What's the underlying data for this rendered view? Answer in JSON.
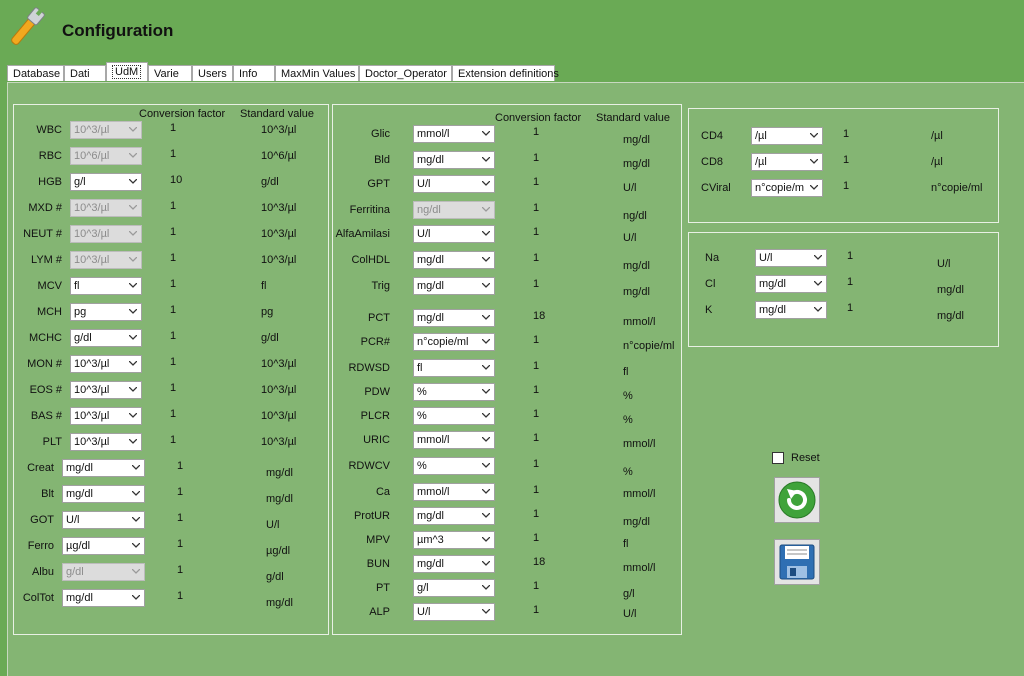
{
  "header": {
    "title": "Configuration",
    "icon": "wrench-icon"
  },
  "tabs": [
    {
      "label": "Database"
    },
    {
      "label": "Dati"
    },
    {
      "label": "UdM",
      "active": true
    },
    {
      "label": "Varie"
    },
    {
      "label": "Users"
    },
    {
      "label": "Info"
    },
    {
      "label": "MaxMin Values"
    },
    {
      "label": "Doctor_Operator"
    },
    {
      "label": "Extension definitions"
    }
  ],
  "group1": {
    "header_factor": "Conversion factor",
    "header_standard": "Standard value",
    "rows": [
      {
        "name": "WBC",
        "unit": "10^3/µl",
        "disabled": true,
        "factor": "1",
        "standard": "10^3/µl"
      },
      {
        "name": "RBC",
        "unit": "10^6/µl",
        "disabled": true,
        "factor": "1",
        "standard": "10^6/µl"
      },
      {
        "name": "HGB",
        "unit": "g/l",
        "disabled": false,
        "factor": "10",
        "standard": "g/dl"
      },
      {
        "name": "MXD #",
        "unit": "10^3/µl",
        "disabled": true,
        "factor": "1",
        "standard": "10^3/µl"
      },
      {
        "name": "NEUT #",
        "unit": "10^3/µl",
        "disabled": true,
        "factor": "1",
        "standard": "10^3/µl"
      },
      {
        "name": "LYM #",
        "unit": "10^3/µl",
        "disabled": true,
        "factor": "1",
        "standard": "10^3/µl"
      },
      {
        "name": "MCV",
        "unit": "fl",
        "disabled": false,
        "factor": "1",
        "standard": "fl"
      },
      {
        "name": "MCH",
        "unit": "pg",
        "disabled": false,
        "factor": "1",
        "standard": "pg"
      },
      {
        "name": "MCHC",
        "unit": "g/dl",
        "disabled": false,
        "factor": "1",
        "standard": "g/dl"
      },
      {
        "name": "MON #",
        "unit": "10^3/µl",
        "disabled": false,
        "factor": "1",
        "standard": "10^3/µl"
      },
      {
        "name": "EOS #",
        "unit": "10^3/µl",
        "disabled": false,
        "factor": "1",
        "standard": "10^3/µl"
      },
      {
        "name": "BAS #",
        "unit": "10^3/µl",
        "disabled": false,
        "factor": "1",
        "standard": "10^3/µl"
      },
      {
        "name": "PLT",
        "unit": "10^3/µl",
        "disabled": false,
        "factor": "1",
        "standard": "10^3/µl"
      },
      {
        "name": "Creat",
        "unit": "mg/dl",
        "disabled": false,
        "factor": "1",
        "standard": "mg/dl"
      },
      {
        "name": "Blt",
        "unit": "mg/dl",
        "disabled": false,
        "factor": "1",
        "standard": "mg/dl"
      },
      {
        "name": "GOT",
        "unit": "U/l",
        "disabled": false,
        "factor": "1",
        "standard": "U/l"
      },
      {
        "name": "Ferro",
        "unit": "µg/dl",
        "disabled": false,
        "factor": "1",
        "standard": "µg/dl"
      },
      {
        "name": "Albu",
        "unit": "g/dl",
        "disabled": true,
        "factor": "1",
        "standard": "g/dl"
      },
      {
        "name": "ColTot",
        "unit": "mg/dl",
        "disabled": false,
        "factor": "1",
        "standard": "mg/dl"
      }
    ]
  },
  "group2": {
    "header_factor": "Conversion factor",
    "header_standard": "Standard value",
    "rows": [
      {
        "name": "Glic",
        "unit": "mmol/l",
        "disabled": false,
        "factor": "1",
        "standard": "mg/dl"
      },
      {
        "name": "Bld",
        "unit": "mg/dl",
        "disabled": false,
        "factor": "1",
        "standard": "mg/dl"
      },
      {
        "name": "GPT",
        "unit": "U/l",
        "disabled": false,
        "factor": "1",
        "standard": "U/l"
      },
      {
        "name": "Ferritina",
        "unit": "ng/dl",
        "disabled": true,
        "factor": "1",
        "standard": "ng/dl"
      },
      {
        "name": "AlfaAmilasi",
        "unit": "U/l",
        "disabled": false,
        "factor": "1",
        "standard": "U/l"
      },
      {
        "name": "ColHDL",
        "unit": "mg/dl",
        "disabled": false,
        "factor": "1",
        "standard": "mg/dl"
      },
      {
        "name": "Trig",
        "unit": "mg/dl",
        "disabled": false,
        "factor": "1",
        "standard": "mg/dl"
      },
      {
        "name": "PCT",
        "unit": "mg/dl",
        "disabled": false,
        "factor": "18",
        "standard": "mmol/l"
      },
      {
        "name": "PCR#",
        "unit": "n°copie/ml",
        "disabled": false,
        "factor": "1",
        "standard": "n°copie/ml"
      },
      {
        "name": "RDWSD",
        "unit": "fl",
        "disabled": false,
        "factor": "1",
        "standard": "fl"
      },
      {
        "name": "PDW",
        "unit": "%",
        "disabled": false,
        "factor": "1",
        "standard": "%"
      },
      {
        "name": "PLCR",
        "unit": "%",
        "disabled": false,
        "factor": "1",
        "standard": "%"
      },
      {
        "name": "URIC",
        "unit": "mmol/l",
        "disabled": false,
        "factor": "1",
        "standard": "mmol/l"
      },
      {
        "name": "RDWCV",
        "unit": "%",
        "disabled": false,
        "factor": "1",
        "standard": "%"
      },
      {
        "name": "Ca",
        "unit": "mmol/l",
        "disabled": false,
        "factor": "1",
        "standard": "mmol/l"
      },
      {
        "name": "ProtUR",
        "unit": "mg/dl",
        "disabled": false,
        "factor": "1",
        "standard": "mg/dl"
      },
      {
        "name": "MPV",
        "unit": "µm^3",
        "disabled": false,
        "factor": "1",
        "standard": "fl"
      },
      {
        "name": "BUN",
        "unit": "mg/dl",
        "disabled": false,
        "factor": "18",
        "standard": "mmol/l"
      },
      {
        "name": "PT",
        "unit": "g/l",
        "disabled": false,
        "factor": "1",
        "standard": "g/l"
      },
      {
        "name": "ALP",
        "unit": "U/l",
        "disabled": false,
        "factor": "1",
        "standard": "U/l"
      }
    ]
  },
  "group3": {
    "rows": [
      {
        "name": "CD4",
        "unit": "/µl",
        "disabled": false,
        "factor": "1",
        "standard": "/µl"
      },
      {
        "name": "CD8",
        "unit": "/µl",
        "disabled": false,
        "factor": "1",
        "standard": "/µl"
      },
      {
        "name": "CViral",
        "unit": "n°copie/m",
        "disabled": false,
        "factor": "1",
        "standard": "n°copie/ml"
      }
    ]
  },
  "group4": {
    "rows": [
      {
        "name": "Na",
        "unit": "U/l",
        "disabled": false,
        "factor": "1",
        "standard": "U/l"
      },
      {
        "name": "Cl",
        "unit": "mg/dl",
        "disabled": false,
        "factor": "1",
        "standard": "mg/dl"
      },
      {
        "name": "K",
        "unit": "mg/dl",
        "disabled": false,
        "factor": "1",
        "standard": "mg/dl"
      }
    ]
  },
  "actions": {
    "reset_label": "Reset",
    "reset_checked": false,
    "reset_icon": "refresh-icon",
    "save_icon": "floppy-disk-icon"
  },
  "colors": {
    "background": "#6aaa55",
    "panel": "#84b573",
    "refresh_green": "#3fa33a",
    "floppy_blue": "#2f6fb3"
  }
}
